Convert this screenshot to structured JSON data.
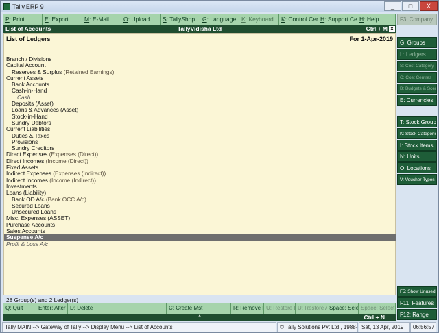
{
  "window": {
    "title": "Tally.ERP 9",
    "minimize": "_",
    "maximize": "□",
    "close": "X"
  },
  "topbar": [
    {
      "key": "P",
      "label": ": Print",
      "enabled": true
    },
    {
      "key": "E",
      "label": ": Export",
      "enabled": true
    },
    {
      "key": "M",
      "label": ": E-Mail",
      "enabled": true
    },
    {
      "key": "O",
      "label": ": Upload",
      "enabled": true
    },
    {
      "key": "S",
      "label": ": TallyShop",
      "enabled": true
    },
    {
      "key": "G",
      "label": ": Language",
      "enabled": true
    },
    {
      "key": "K",
      "label": ": Keyboard",
      "enabled": false
    },
    {
      "key": "K",
      "label": ": Control Centre",
      "enabled": true
    },
    {
      "key": "H",
      "label": ": Support Centre",
      "enabled": true
    },
    {
      "key": "H",
      "label": ": Help",
      "enabled": true
    }
  ],
  "header": {
    "title": "List of Accounts",
    "company": "TallyVidisha Ltd",
    "shortcut": "Ctrl + M",
    "close": "x"
  },
  "subheader": {
    "title": "List of Ledgers",
    "date": "For 1-Apr-2019"
  },
  "tree": [
    {
      "text": "Branch / Divisions",
      "alias": "",
      "indent": 0,
      "type": "group"
    },
    {
      "text": "Capital Account",
      "alias": "",
      "indent": 0,
      "type": "group"
    },
    {
      "text": "Reserves & Surplus",
      "alias": "(Retained Earnings)",
      "indent": 1,
      "type": "group"
    },
    {
      "text": "Current Assets",
      "alias": "",
      "indent": 0,
      "type": "group"
    },
    {
      "text": "Bank Accounts",
      "alias": "",
      "indent": 1,
      "type": "group"
    },
    {
      "text": "Cash-in-Hand",
      "alias": "",
      "indent": 1,
      "type": "group"
    },
    {
      "text": "Cash",
      "alias": "",
      "indent": 2,
      "type": "ledger"
    },
    {
      "text": "Deposits (Asset)",
      "alias": "",
      "indent": 1,
      "type": "group"
    },
    {
      "text": "Loans & Advances (Asset)",
      "alias": "",
      "indent": 1,
      "type": "group"
    },
    {
      "text": "Stock-in-Hand",
      "alias": "",
      "indent": 1,
      "type": "group"
    },
    {
      "text": "Sundry Debtors",
      "alias": "",
      "indent": 1,
      "type": "group"
    },
    {
      "text": "Current Liabilities",
      "alias": "",
      "indent": 0,
      "type": "group"
    },
    {
      "text": "Duties & Taxes",
      "alias": "",
      "indent": 1,
      "type": "group"
    },
    {
      "text": "Provisions",
      "alias": "",
      "indent": 1,
      "type": "group"
    },
    {
      "text": "Sundry Creditors",
      "alias": "",
      "indent": 1,
      "type": "group"
    },
    {
      "text": "Direct Expenses",
      "alias": "(Expenses (Direct))",
      "indent": 0,
      "type": "group"
    },
    {
      "text": "Direct Incomes",
      "alias": "(Income (Direct))",
      "indent": 0,
      "type": "group"
    },
    {
      "text": "Fixed Assets",
      "alias": "",
      "indent": 0,
      "type": "group"
    },
    {
      "text": "Indirect Expenses",
      "alias": "(Expenses (Indirect))",
      "indent": 0,
      "type": "group"
    },
    {
      "text": "Indirect Incomes",
      "alias": "(Income (Indirect))",
      "indent": 0,
      "type": "group"
    },
    {
      "text": "Investments",
      "alias": "",
      "indent": 0,
      "type": "group"
    },
    {
      "text": "Loans (Liability)",
      "alias": "",
      "indent": 0,
      "type": "group"
    },
    {
      "text": "Bank OD A/c",
      "alias": "(Bank OCC A/c)",
      "indent": 1,
      "type": "group"
    },
    {
      "text": "Secured Loans",
      "alias": "",
      "indent": 1,
      "type": "group"
    },
    {
      "text": "Unsecured Loans",
      "alias": "",
      "indent": 1,
      "type": "group"
    },
    {
      "text": "Misc. Expenses (ASSET)",
      "alias": "",
      "indent": 0,
      "type": "group"
    },
    {
      "text": "Purchase Accounts",
      "alias": "",
      "indent": 0,
      "type": "group"
    },
    {
      "text": "Sales Accounts",
      "alias": "",
      "indent": 0,
      "type": "group"
    },
    {
      "text": "Suspense A/c",
      "alias": "",
      "indent": 0,
      "type": "selected"
    },
    {
      "text": "Profit & Loss A/c",
      "alias": "",
      "indent": 0,
      "type": "ledger"
    }
  ],
  "footer": {
    "summary": "28 Group(s)  and  2 Ledger(s)"
  },
  "bottombar": [
    {
      "label": "Q: Quit",
      "enabled": true,
      "w": 48
    },
    {
      "label": "Enter: Alter",
      "enabled": true,
      "w": 46
    },
    {
      "label": "D: Delete",
      "enabled": true,
      "w": 144
    },
    {
      "label": "C: Create Mst",
      "enabled": true,
      "w": 94
    },
    {
      "label": "R: Remove Line",
      "enabled": true,
      "w": 48
    },
    {
      "label": "U: Restore Line",
      "enabled": false,
      "w": 46
    },
    {
      "label": "U: Restore All",
      "enabled": false,
      "w": 46
    },
    {
      "label": "Space: Select",
      "enabled": true,
      "w": 46
    },
    {
      "label": "Space: Select All",
      "enabled": false,
      "w": 54
    }
  ],
  "ctrl_n": {
    "arrow": "^",
    "shortcut": "Ctrl + N"
  },
  "statusbar": {
    "path": "Tally MAIN --> Gateway of Tally --> Display Menu --> List of Accounts",
    "copyright": "© Tally Solutions Pvt Ltd., 1988-20",
    "date": "Sat, 13 Apr, 2019",
    "time": "06:56:57"
  },
  "sidebar": [
    {
      "label": "F3: Company",
      "style": "dim"
    },
    {
      "label": "G: Groups",
      "style": "normal"
    },
    {
      "label": "L: Ledgers",
      "style": "dim"
    },
    {
      "label": "S: Cost Category",
      "style": "dimsmall"
    },
    {
      "label": "C: Cost Centres",
      "style": "dimsmall"
    },
    {
      "label": "B: Budgets & Scenarios",
      "style": "dimsmall"
    },
    {
      "label": "E: Currencies",
      "style": "normal"
    },
    {
      "label": "T: Stock Groups",
      "style": "normal"
    },
    {
      "label": "K: Stock Categories",
      "style": "small"
    },
    {
      "label": "I: Stock Items",
      "style": "normal"
    },
    {
      "label": "N: Units",
      "style": "normal"
    },
    {
      "label": "O: Locations",
      "style": "normal"
    },
    {
      "label": "V: Voucher Types",
      "style": "small"
    },
    {
      "label": "F5: Show Unused",
      "style": "small"
    },
    {
      "label": "F11: Features",
      "style": "normal"
    },
    {
      "label": "F12: Range",
      "style": "normal"
    }
  ]
}
